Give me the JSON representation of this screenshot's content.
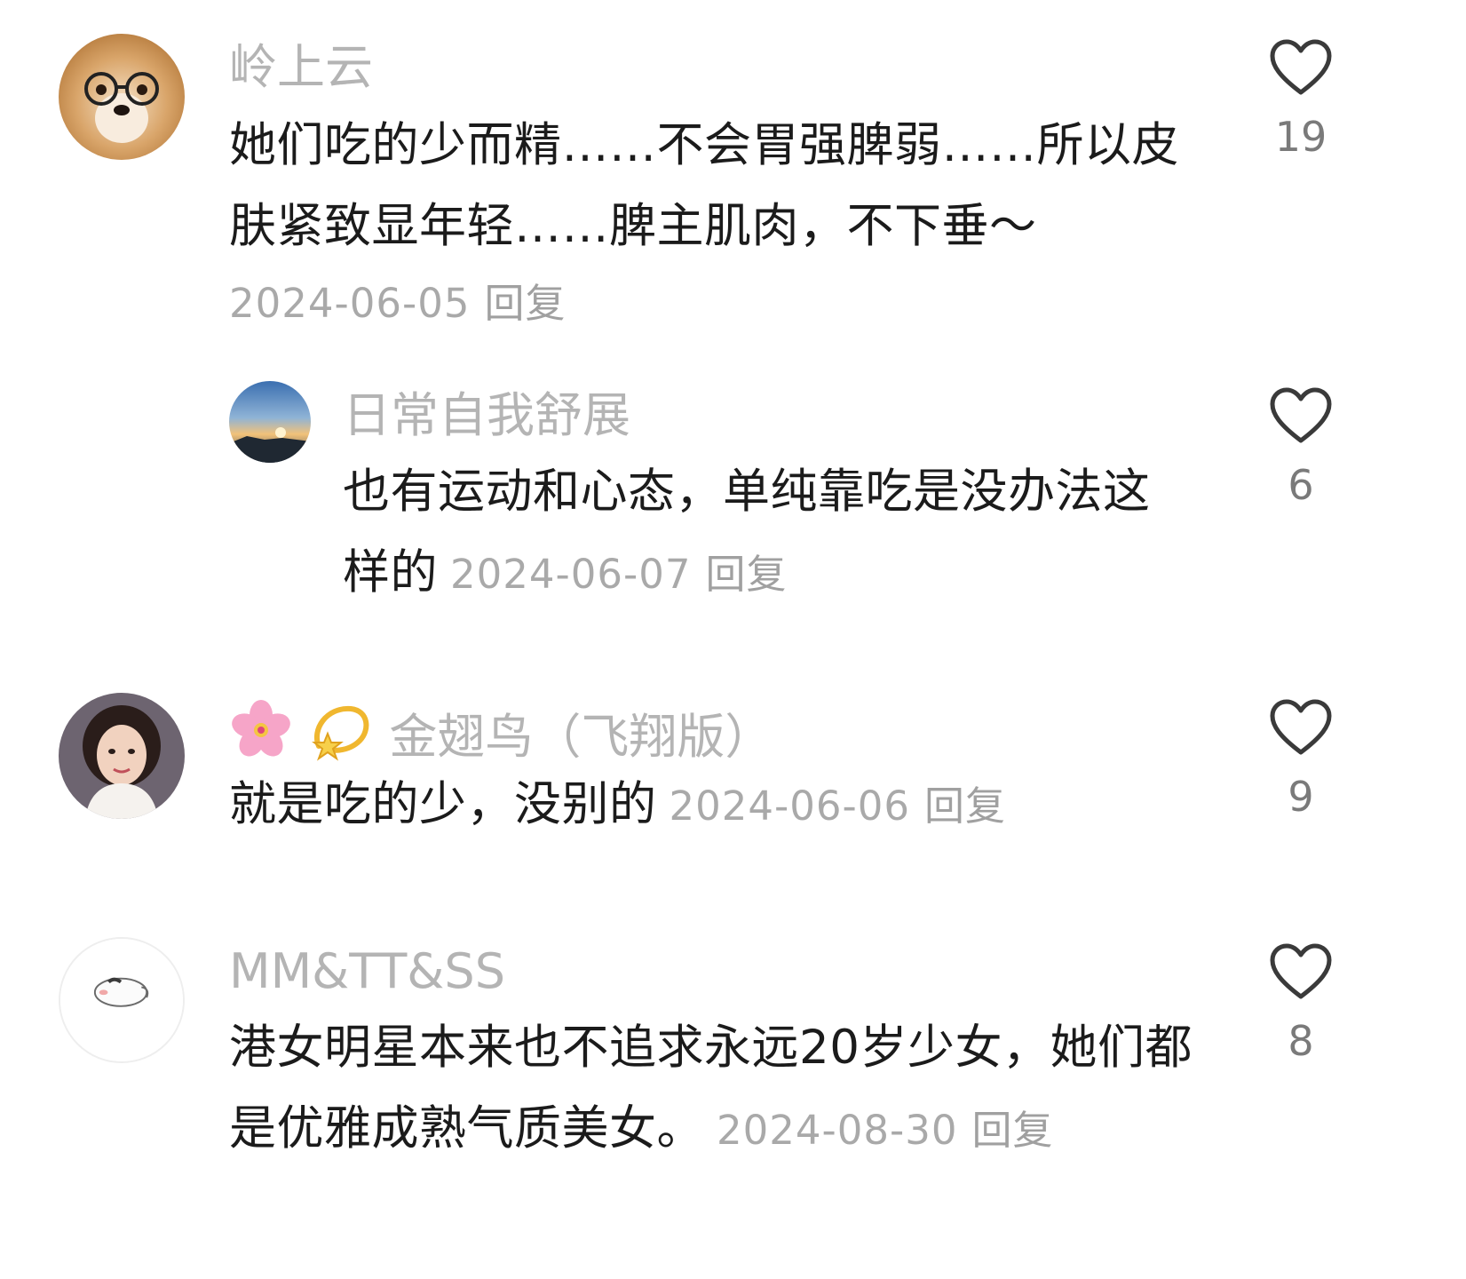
{
  "comments": [
    {
      "username": "岭上云",
      "avatar": "glasses-dog-avatar",
      "text": "她们吃的少而精……不会胃强脾弱……所以皮肤紧致显年轻……脾主肌肉，不下垂～",
      "date": "2024-06-05",
      "reply_label": "回复",
      "likes": "19",
      "reply": {
        "username": "日常自我舒展",
        "avatar": "sunset-landscape-avatar",
        "text": "也有运动和心态，单纯靠吃是没办法这样的",
        "date": "2024-06-07",
        "reply_label": "回复",
        "likes": "6"
      }
    },
    {
      "username_emoji": [
        "cherry-blossom-icon",
        "dizzy-star-icon"
      ],
      "username": "金翅鸟（飞翔版）",
      "avatar": "woman-portrait-avatar",
      "text": "就是吃的少，没别的",
      "date": "2024-06-06",
      "reply_label": "回复",
      "likes": "9"
    },
    {
      "username": "MM&TT&SS",
      "avatar": "sleeping-animal-avatar",
      "text": "港女明星本来也不追求永远20岁少女，她们都是优雅成熟气质美女。",
      "date": "2024-08-30",
      "reply_label": "回复",
      "likes": "8"
    }
  ],
  "colors": {
    "username": "#b4b4b4",
    "text": "#1b1b1b",
    "meta": "#a9a9a9",
    "heart_stroke": "#3a3a3a"
  }
}
